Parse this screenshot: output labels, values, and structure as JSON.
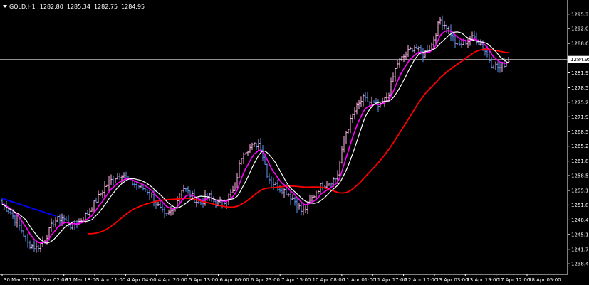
{
  "window": {
    "symbol": "GOLD,H1",
    "open": "1282.80",
    "high": "1285.34",
    "low": "1282.75",
    "close": "1284.95"
  },
  "chart_data": {
    "type": "candlestick",
    "symbol": "GOLD",
    "timeframe": "H1",
    "ylim": [
      1236.0,
      1298.5
    ],
    "price_ticks": [
      "1295.30",
      "1292.00",
      "1288.60",
      "1284.95",
      "1281.90",
      "1278.50",
      "1275.20",
      "1271.90",
      "1268.50",
      "1265.20",
      "1261.80",
      "1258.50",
      "1255.10",
      "1251.80",
      "1248.40",
      "1245.10",
      "1241.70",
      "1238.40"
    ],
    "current_price": "1284.95",
    "time_labels": [
      "30 Mar 2017",
      "31 Mar 02:00",
      "31 Mar 18:00",
      "3 Apr 11:00",
      "4 Apr 04:00",
      "4 Apr 20:00",
      "5 Apr 13:00",
      "6 Apr 06:00",
      "6 Apr 23:00",
      "7 Apr 15:00",
      "10 Apr 08:00",
      "11 Apr 01:00",
      "11 Apr 17:00",
      "12 Apr 10:00",
      "13 Apr 03:00",
      "13 Apr 19:00",
      "17 Apr 12:00",
      "18 Apr 05:00"
    ],
    "close_path": [
      1252,
      1250,
      1247,
      1243,
      1242,
      1244,
      1248,
      1249,
      1247,
      1248,
      1250,
      1253,
      1256,
      1258,
      1259,
      1257,
      1256,
      1255,
      1252,
      1249,
      1251,
      1256,
      1254,
      1252,
      1254,
      1252,
      1253,
      1255,
      1264,
      1265,
      1266,
      1258,
      1256,
      1255,
      1253,
      1250,
      1253,
      1256,
      1257,
      1258,
      1268,
      1273,
      1276,
      1275,
      1274,
      1277,
      1284,
      1286,
      1288,
      1286,
      1288,
      1294,
      1292,
      1288,
      1289,
      1290,
      1288,
      1284,
      1283,
      1284.95
    ],
    "moving_averages": [
      {
        "color": "#0000ff",
        "period": "long"
      },
      {
        "color": "#ff0000",
        "period": "medium"
      },
      {
        "color": "#ff00ff",
        "period": "short"
      },
      {
        "color": "#ffffff",
        "period": "fast"
      }
    ],
    "colors": {
      "background": "#000000",
      "bull_candle": "#ffb6e6",
      "bear_candle": "#6495ed",
      "axis": "#ffffff",
      "price_line": "#c0c0c0"
    }
  }
}
